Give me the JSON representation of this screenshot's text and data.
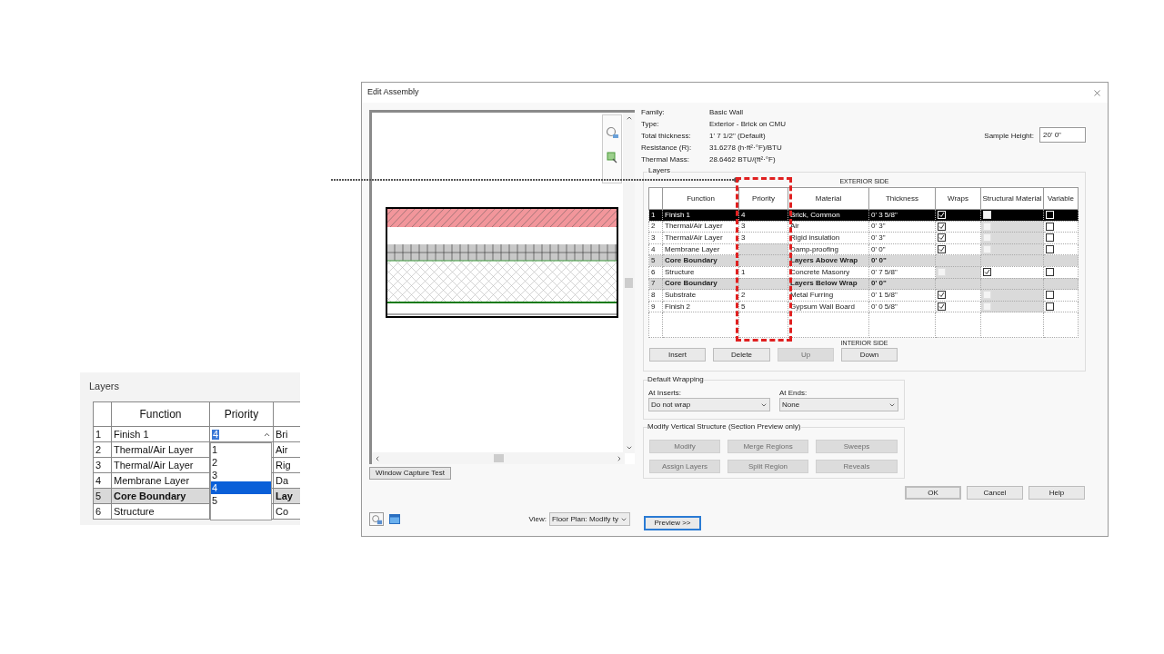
{
  "inset": {
    "title": "Layers",
    "columns": [
      "Function",
      "Priority"
    ],
    "rows": [
      {
        "number": "1",
        "function": "Finish 1",
        "priority": "4",
        "material": "Bri",
        "kind": "layer"
      },
      {
        "number": "2",
        "function": "Thermal/Air Layer",
        "material": "Air",
        "kind": "layer"
      },
      {
        "number": "3",
        "function": "Thermal/Air Layer",
        "material": "Rig",
        "kind": "layer"
      },
      {
        "number": "4",
        "function": "Membrane Layer",
        "material": "Da",
        "kind": "layer"
      },
      {
        "number": "5",
        "function": "Core Boundary",
        "material": "Lay",
        "kind": "boundary"
      },
      {
        "number": "6",
        "function": "Structure",
        "material": "Co",
        "kind": "layer"
      }
    ],
    "options": [
      {
        "label": "1",
        "selected": false
      },
      {
        "label": "2",
        "selected": false
      },
      {
        "label": "3",
        "selected": false
      },
      {
        "label": "4",
        "selected": true
      },
      {
        "label": "5",
        "selected": false
      }
    ]
  },
  "dialog": {
    "title": "Edit Assembly",
    "properties": [
      {
        "label": "Family:",
        "value": "Basic Wall"
      },
      {
        "label": "Type:",
        "value": "Exterior - Brick on CMU"
      },
      {
        "label": "Total thickness:",
        "value": "1'  7 1/2\" (Default)"
      },
      {
        "label": "Resistance (R):",
        "value": "31.6278 (h·ft²·°F)/BTU"
      },
      {
        "label": "Thermal Mass:",
        "value": "28.6462 BTU/(ft²·°F)"
      }
    ],
    "sample_height": {
      "label": "Sample Height:",
      "value": "20'  0\""
    },
    "layers": {
      "title": "Layers",
      "exterior_label": "EXTERIOR SIDE",
      "interior_label": "INTERIOR SIDE",
      "columns": [
        "Function",
        "Priority",
        "Material",
        "Thickness",
        "Wraps",
        "Structural Material",
        "Variable"
      ],
      "rows": [
        {
          "number": "1",
          "function": "Finish 1",
          "priority": "4",
          "material": "Brick, Common",
          "thickness": "0'  3 5/8\"",
          "kind": "layer",
          "selected": true,
          "wraps": true,
          "wraps_disabled": false,
          "structural": false,
          "structural_disabled": true,
          "variable": false
        },
        {
          "number": "2",
          "function": "Thermal/Air Layer",
          "priority": "3",
          "material": "Air",
          "thickness": "0'  3\"",
          "kind": "layer",
          "selected": false,
          "wraps": true,
          "wraps_disabled": false,
          "structural": false,
          "structural_disabled": true,
          "variable": false
        },
        {
          "number": "3",
          "function": "Thermal/Air Layer",
          "priority": "3",
          "material": "Rigid insulation",
          "thickness": "0'  3\"",
          "kind": "layer",
          "selected": false,
          "wraps": true,
          "wraps_disabled": false,
          "structural": false,
          "structural_disabled": true,
          "variable": false
        },
        {
          "number": "4",
          "function": "Membrane Layer",
          "material": "Damp-proofing",
          "thickness": "0'  0\"",
          "kind": "layer",
          "selected": false,
          "wraps": true,
          "wraps_disabled": false,
          "structural": false,
          "structural_disabled": true,
          "variable": false
        },
        {
          "number": "5",
          "function": "Core Boundary",
          "material": "Layers Above Wrap",
          "thickness": "0'  0\"",
          "kind": "boundary",
          "selected": false
        },
        {
          "number": "6",
          "function": "Structure",
          "priority": "1",
          "material": "Concrete Masonry",
          "thickness": "0'  7 5/8\"",
          "kind": "layer",
          "selected": false,
          "wraps": false,
          "wraps_disabled": true,
          "structural": true,
          "structural_disabled": false,
          "variable": false
        },
        {
          "number": "7",
          "function": "Core Boundary",
          "material": "Layers Below Wrap",
          "thickness": "0'  0\"",
          "kind": "boundary",
          "selected": false
        },
        {
          "number": "8",
          "function": "Substrate",
          "priority": "2",
          "material": "Metal Furring",
          "thickness": "0'  1 5/8\"",
          "kind": "layer",
          "selected": false,
          "wraps": true,
          "wraps_disabled": false,
          "structural": false,
          "structural_disabled": true,
          "variable": false
        },
        {
          "number": "9",
          "function": "Finish 2",
          "priority": "5",
          "material": "Gypsum Wall Board",
          "thickness": "0'  0 5/8\"",
          "kind": "layer",
          "selected": false,
          "wraps": true,
          "wraps_disabled": false,
          "structural": false,
          "structural_disabled": true,
          "variable": false
        }
      ],
      "buttons": [
        {
          "label": "Insert",
          "disabled": false
        },
        {
          "label": "Delete",
          "disabled": false
        },
        {
          "label": "Up",
          "disabled": true
        },
        {
          "label": "Down",
          "disabled": false
        }
      ]
    },
    "default_wrapping": {
      "title": "Default Wrapping",
      "at_inserts": {
        "label": "At Inserts:",
        "value": "Do not wrap"
      },
      "at_ends": {
        "label": "At Ends:",
        "value": "None"
      }
    },
    "vertical_structure": {
      "title": "Modify Vertical Structure (Section Preview only)",
      "buttons": [
        {
          "label": "Modify",
          "disabled": true
        },
        {
          "label": "Merge Regions",
          "disabled": true
        },
        {
          "label": "Sweeps",
          "disabled": true
        },
        {
          "label": "Assign Layers",
          "disabled": true
        },
        {
          "label": "Split Region",
          "disabled": true
        },
        {
          "label": "Reveals",
          "disabled": true
        }
      ]
    },
    "footer_buttons": [
      {
        "label": "OK",
        "default": true
      },
      {
        "label": "Cancel",
        "default": false
      },
      {
        "label": "Help",
        "default": false
      }
    ],
    "window_capture_button": "Window Capture Test",
    "view": {
      "label": "View:",
      "value": "Floor Plan: Modify ty"
    },
    "preview_button": "Preview >>"
  }
}
